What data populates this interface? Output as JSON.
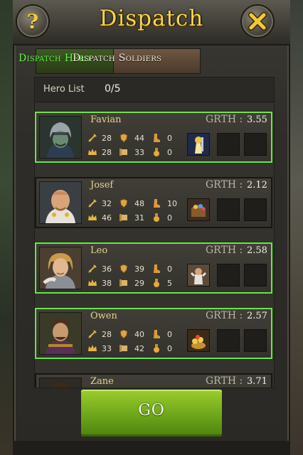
{
  "window": {
    "title": "Dispatch",
    "help_label": "?"
  },
  "tabs": [
    {
      "label": "Dispatch Hero",
      "active": true,
      "color": "#6cf04a"
    },
    {
      "label": "Dispatch Soldiers",
      "active": false
    }
  ],
  "hero_list": {
    "label": "Hero List",
    "count": "0/5"
  },
  "heroes": [
    {
      "name": "Favian",
      "grth_label": "GRTH :",
      "grth": "3.55",
      "stats": [
        "28",
        "44",
        "0",
        "28",
        "33",
        "0"
      ],
      "selected": true,
      "item": "soldier-item-icon"
    },
    {
      "name": "Josef",
      "grth_label": "GRTH :",
      "grth": "2.12",
      "stats": [
        "32",
        "48",
        "10",
        "46",
        "31",
        "0"
      ],
      "selected": false,
      "item": "treasure-item-icon"
    },
    {
      "name": "Leo",
      "grth_label": "GRTH :",
      "grth": "2.58",
      "stats": [
        "36",
        "39",
        "0",
        "38",
        "29",
        "5"
      ],
      "selected": true,
      "item": "hero-item-icon"
    },
    {
      "name": "Owen",
      "grth_label": "GRTH :",
      "grth": "2.57",
      "stats": [
        "28",
        "40",
        "0",
        "33",
        "42",
        "0"
      ],
      "selected": true,
      "item": "gold-item-icon"
    },
    {
      "name": "Zane",
      "grth_label": "GRTH :",
      "grth": "3.71",
      "stats": [],
      "selected": false,
      "item": null
    }
  ],
  "actions": {
    "go_label": "GO"
  },
  "colors": {
    "title": "#f7d64a",
    "selected_border": "#6fe24f",
    "go_button": "#7fb421"
  }
}
